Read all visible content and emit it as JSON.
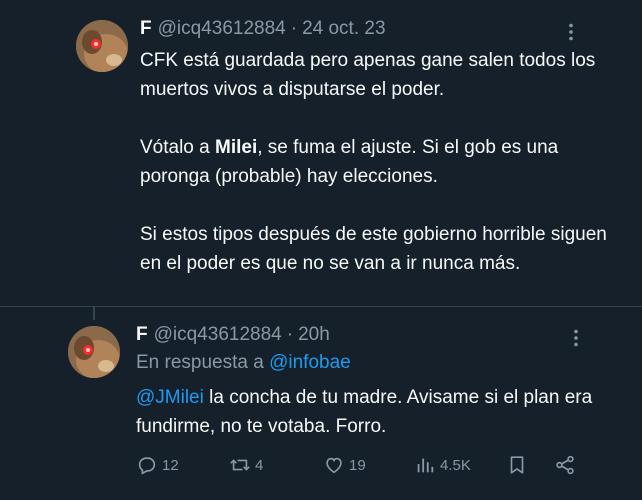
{
  "tweet1": {
    "name": "F",
    "handle": "@icq43612884",
    "separator": "·",
    "date": "24 oct. 23",
    "body": {
      "p1": "CFK está guardada pero apenas gane salen todos los muertos vivos a disputarse el poder.",
      "p2_pre": "Vótalo a ",
      "p2_bold": "Milei",
      "p2_post": ", se fuma  el ajuste. Si el  gob es una poronga  (probable) hay elecciones.",
      "p3": "Si estos tipos después de este gobierno horrible siguen en el poder es que no se van a ir nunca más."
    }
  },
  "tweet2": {
    "name": "F",
    "handle": "@icq43612884",
    "separator": "·",
    "date": "20h",
    "reply_prefix": "En respuesta a ",
    "reply_to": "@infobae",
    "mention": "@JMilei",
    "body_rest": " la concha de tu madre. Avisame si el plan era fundirme, no te votaba. Forro.",
    "stats": {
      "replies": "12",
      "retweets": "4",
      "likes": "19",
      "views": "4.5K"
    }
  },
  "colors": {
    "background": "#15202b",
    "text": "#f7f9f9",
    "muted": "#8b98a5",
    "link": "#1d9bf0",
    "divider": "#38444d"
  },
  "icons": [
    "avatar",
    "more-icon",
    "reply-icon",
    "retweet-icon",
    "like-icon",
    "views-icon",
    "bookmark-icon",
    "share-icon"
  ]
}
